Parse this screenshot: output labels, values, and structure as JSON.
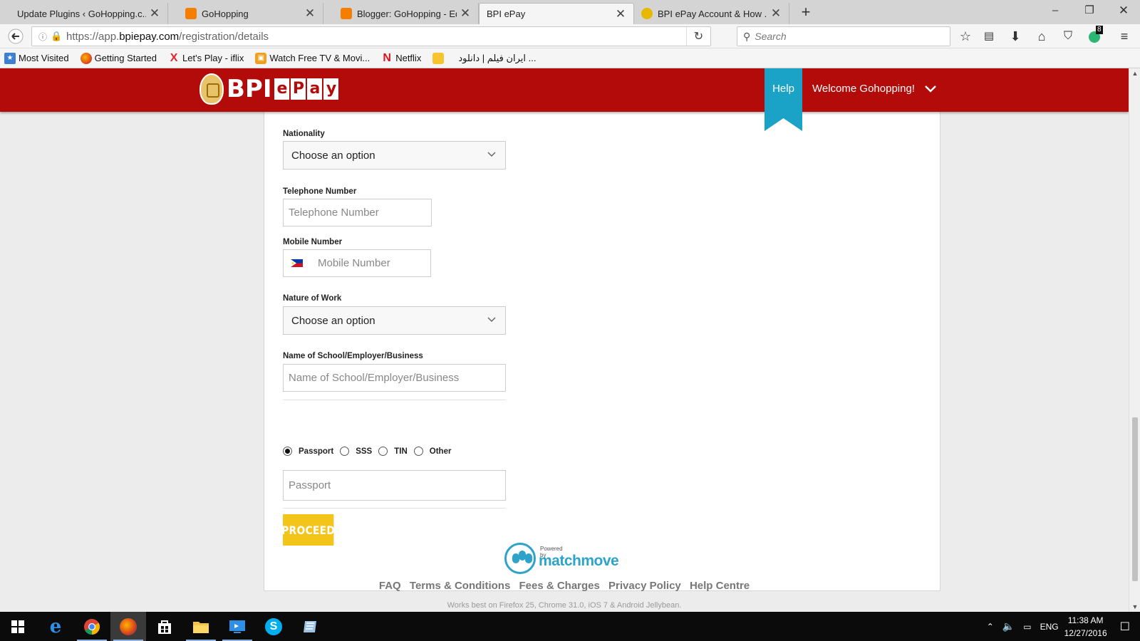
{
  "browser": {
    "tabs": [
      {
        "title": "Update Plugins ‹ GoHopping.c...",
        "icon": "wordpress-icon",
        "active": false
      },
      {
        "title": "GoHopping",
        "icon": "blogger-icon",
        "active": false
      },
      {
        "title": "Blogger: GoHopping - Edi...",
        "icon": "blogger-icon",
        "active": false
      },
      {
        "title": "BPI ePay",
        "icon": "",
        "active": true
      },
      {
        "title": "BPI ePay Account & How ...",
        "icon": "gohopping-icon",
        "active": false
      }
    ],
    "url_prefix": "https://app.",
    "url_domain": "bpiepay.com",
    "url_path": "/registration/details",
    "search_placeholder": "Search",
    "badge_count": "8",
    "bookmarks": [
      {
        "label": "Most Visited",
        "icon": "most-visited-icon"
      },
      {
        "label": "Getting Started",
        "icon": "firefox-icon"
      },
      {
        "label": "Let's Play - iflix",
        "icon": "iflix-icon"
      },
      {
        "label": "Watch Free TV & Movi...",
        "icon": "tv-icon"
      },
      {
        "label": "Netflix",
        "icon": "netflix-icon"
      },
      {
        "label": "ایران فیلم | دانلود ...",
        "icon": "tv2-icon"
      }
    ]
  },
  "site": {
    "logo_bpi": "BPI",
    "logo_epay": [
      "e",
      "P",
      "a",
      "y"
    ],
    "help_label": "Help",
    "welcome": "Welcome Gohopping!"
  },
  "form": {
    "nationality_label": "Nationality",
    "nationality_value": "Choose an option",
    "telephone_label": "Telephone Number",
    "telephone_placeholder": "Telephone Number",
    "mobile_label": "Mobile Number",
    "mobile_placeholder": "Mobile Number",
    "work_label": "Nature of Work",
    "work_value": "Choose an option",
    "employer_label": "Name of School/Employer/Business",
    "employer_placeholder": "Name of School/Employer/Business",
    "id_types": [
      {
        "label": "Passport",
        "checked": true
      },
      {
        "label": "SSS",
        "checked": false
      },
      {
        "label": "TIN",
        "checked": false
      },
      {
        "label": "Other",
        "checked": false
      }
    ],
    "id_placeholder": "Passport",
    "proceed_label": "PROCEED"
  },
  "footer": {
    "powered_by": "Powered by",
    "brand": "matchmove",
    "links": [
      "FAQ",
      "Terms & Conditions",
      "Fees & Charges",
      "Privacy Policy",
      "Help Centre"
    ],
    "note": "Works best on Firefox 25, Chrome 31.0, iOS 7 & Android Jellybean."
  },
  "taskbar": {
    "lang": "ENG",
    "time": "11:38 AM",
    "date": "12/27/2016"
  },
  "colors": {
    "brand_red": "#b30a0a",
    "ribbon_teal": "#1aa3c6",
    "proceed_yellow": "#f3c51a",
    "matchmove_blue": "#2ea3c9"
  }
}
